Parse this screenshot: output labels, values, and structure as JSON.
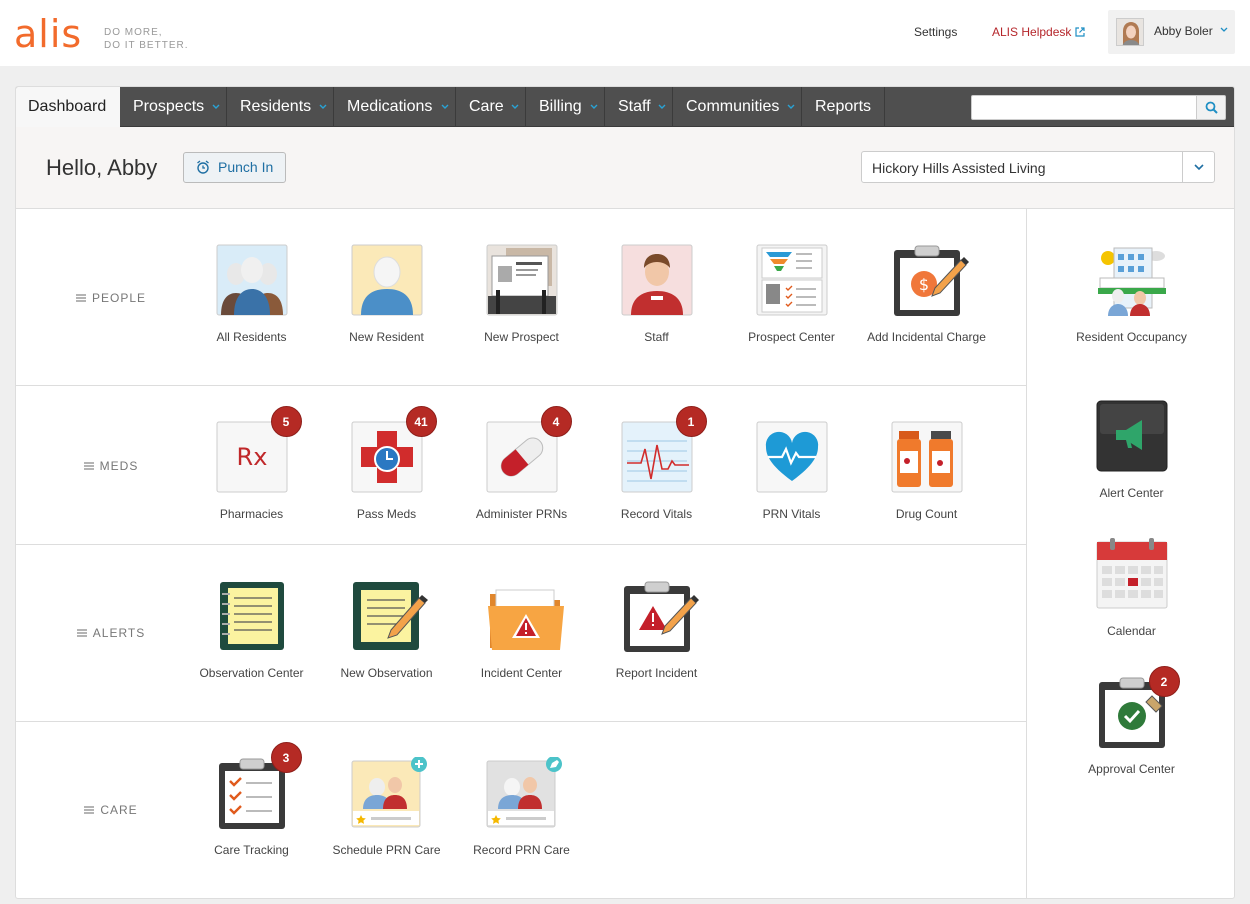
{
  "brand": {
    "logo": "alis",
    "tagline_1": "DO MORE,",
    "tagline_2": "DO IT BETTER."
  },
  "topnav": {
    "settings": "Settings",
    "helpdesk": "ALIS Helpdesk",
    "user_name": "Abby Boler"
  },
  "nav": {
    "tabs": [
      {
        "label": "Dashboard",
        "active": true
      },
      {
        "label": "Prospects"
      },
      {
        "label": "Residents"
      },
      {
        "label": "Medications"
      },
      {
        "label": "Care"
      },
      {
        "label": "Billing"
      },
      {
        "label": "Staff"
      },
      {
        "label": "Communities"
      },
      {
        "label": "Reports"
      }
    ],
    "search_value": ""
  },
  "greeting": "Hello, Abby",
  "punch_in": "Punch In",
  "community_selected": "Hickory Hills Assisted Living",
  "sections": {
    "people": {
      "label": "PEOPLE",
      "tiles": [
        {
          "label": "All Residents",
          "icon": "residents-group-icon"
        },
        {
          "label": "New Resident",
          "icon": "new-resident-icon"
        },
        {
          "label": "New Prospect",
          "icon": "rolodex-icon"
        },
        {
          "label": "Staff",
          "icon": "staff-person-icon"
        },
        {
          "label": "Prospect Center",
          "icon": "funnel-report-icon"
        },
        {
          "label": "Add Incidental Charge",
          "icon": "clipboard-dollar-icon"
        }
      ]
    },
    "meds": {
      "label": "MEDS",
      "tiles": [
        {
          "label": "Pharmacies",
          "icon": "rx-icon",
          "badge": "5",
          "rx": "Rx"
        },
        {
          "label": "Pass Meds",
          "icon": "pass-meds-icon",
          "badge": "41"
        },
        {
          "label": "Administer PRNs",
          "icon": "capsule-icon",
          "badge": "4"
        },
        {
          "label": "Record Vitals",
          "icon": "ecg-chart-icon",
          "badge": "1"
        },
        {
          "label": "PRN Vitals",
          "icon": "heartbeat-icon"
        },
        {
          "label": "Drug Count",
          "icon": "pill-bottles-icon"
        }
      ]
    },
    "alerts": {
      "label": "ALERTS",
      "tiles": [
        {
          "label": "Observation Center",
          "icon": "notebook-icon"
        },
        {
          "label": "New Observation",
          "icon": "notebook-pencil-icon"
        },
        {
          "label": "Incident Center",
          "icon": "folder-warning-icon"
        },
        {
          "label": "Report Incident",
          "icon": "clipboard-warning-icon"
        }
      ]
    },
    "care": {
      "label": "CARE",
      "tiles": [
        {
          "label": "Care Tracking",
          "icon": "checklist-clipboard-icon",
          "badge": "3"
        },
        {
          "label": "Schedule PRN Care",
          "icon": "schedule-prn-care-icon"
        },
        {
          "label": "Record PRN Care",
          "icon": "record-prn-care-icon"
        }
      ]
    }
  },
  "sidebar": {
    "tiles": [
      {
        "label": "Resident Occupancy",
        "icon": "building-residents-icon"
      },
      {
        "label": "Alert Center",
        "icon": "megaphone-icon"
      },
      {
        "label": "Calendar",
        "icon": "calendar-icon"
      },
      {
        "label": "Approval Center",
        "icon": "approval-clipboard-icon",
        "badge": "2"
      }
    ]
  },
  "colors": {
    "brand_orange": "#f26b2c",
    "nav_bg": "#4f4f4f",
    "badge_red": "#b52a24",
    "link_red": "#b5262b",
    "accent_blue": "#1f8fc4"
  }
}
